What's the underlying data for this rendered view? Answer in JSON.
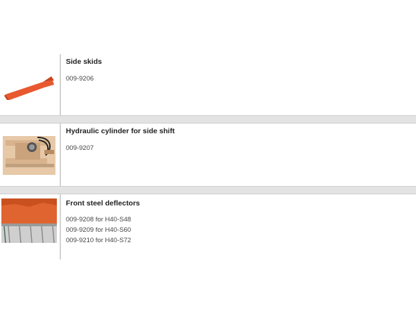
{
  "products": [
    {
      "title": "Side skids",
      "lines": [
        "009-9206"
      ]
    },
    {
      "title": "Hydraulic cylinder for side shift",
      "lines": [
        "009-9207"
      ]
    },
    {
      "title": "Front steel deflectors",
      "lines": [
        "009-9208 for H40-S48",
        "009-9209 for H40-S60",
        "009-9210 for H40-S72"
      ]
    }
  ],
  "colors": {
    "accent": "#e8592f",
    "separator": "#e3e3e3",
    "divider": "#d3d3d3"
  }
}
